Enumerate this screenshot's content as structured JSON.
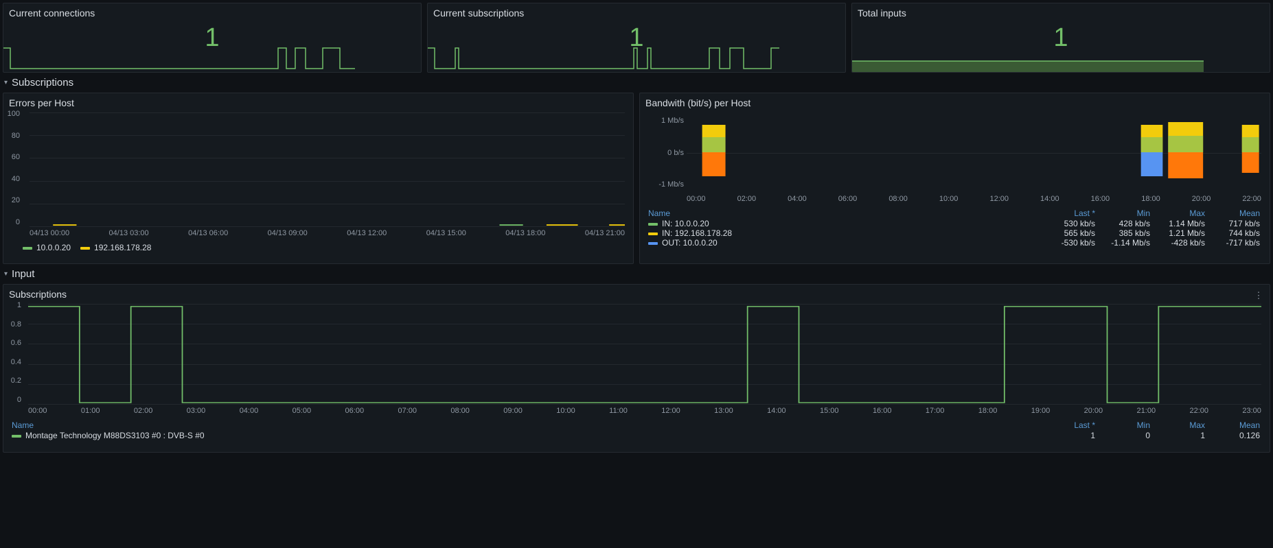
{
  "stats": {
    "connections": {
      "title": "Current connections",
      "value": "1"
    },
    "subscriptions": {
      "title": "Current subscriptions",
      "value": "1"
    },
    "inputs": {
      "title": "Total inputs",
      "value": "1"
    }
  },
  "sections": {
    "subscriptions": "Subscriptions",
    "input": "Input"
  },
  "errors_panel": {
    "title": "Errors per Host",
    "y_ticks": [
      "100",
      "80",
      "60",
      "40",
      "20",
      "0"
    ],
    "x_ticks": [
      "04/13 00:00",
      "04/13 03:00",
      "04/13 06:00",
      "04/13 09:00",
      "04/13 12:00",
      "04/13 15:00",
      "04/13 18:00",
      "04/13 21:00"
    ],
    "legend": [
      {
        "color": "#73bf69",
        "label": "10.0.0.20"
      },
      {
        "color": "#f2cc0c",
        "label": "192.168.178.28"
      }
    ]
  },
  "bandwidth_panel": {
    "title": "Bandwith (bit/s) per Host",
    "y_ticks": [
      "1 Mb/s",
      "0 b/s",
      "-1 Mb/s"
    ],
    "x_ticks": [
      "00:00",
      "02:00",
      "04:00",
      "06:00",
      "08:00",
      "10:00",
      "12:00",
      "14:00",
      "16:00",
      "18:00",
      "20:00",
      "22:00"
    ],
    "headers": {
      "name": "Name",
      "last": "Last *",
      "min": "Min",
      "max": "Max",
      "mean": "Mean"
    },
    "rows": [
      {
        "color": "#73bf69",
        "name": "IN: 10.0.0.20",
        "last": "530 kb/s",
        "min": "428 kb/s",
        "max": "1.14 Mb/s",
        "mean": "717 kb/s"
      },
      {
        "color": "#f2cc0c",
        "name": "IN: 192.168.178.28",
        "last": "565 kb/s",
        "min": "385 kb/s",
        "max": "1.21 Mb/s",
        "mean": "744 kb/s"
      },
      {
        "color": "#5794f2",
        "name": "OUT: 10.0.0.20",
        "last": "-530 kb/s",
        "min": "-1.14 Mb/s",
        "max": "-428 kb/s",
        "mean": "-717 kb/s"
      }
    ]
  },
  "input_subs_panel": {
    "title": "Subscriptions",
    "y_ticks": [
      "1",
      "0.8",
      "0.6",
      "0.4",
      "0.2",
      "0"
    ],
    "x_ticks": [
      "00:00",
      "01:00",
      "02:00",
      "03:00",
      "04:00",
      "05:00",
      "06:00",
      "07:00",
      "08:00",
      "09:00",
      "10:00",
      "11:00",
      "12:00",
      "13:00",
      "14:00",
      "15:00",
      "16:00",
      "17:00",
      "18:00",
      "19:00",
      "20:00",
      "21:00",
      "22:00",
      "23:00"
    ],
    "headers": {
      "name": "Name",
      "last": "Last *",
      "min": "Min",
      "max": "Max",
      "mean": "Mean"
    },
    "rows": [
      {
        "color": "#73bf69",
        "name": "Montage Technology M88DS3103 #0 : DVB-S #0",
        "last": "1",
        "min": "0",
        "max": "1",
        "mean": "0.126"
      }
    ]
  },
  "chart_data": [
    {
      "id": "current_connections_spark",
      "type": "line",
      "title": "Current connections",
      "x_unit": "hour_of_day",
      "y_unit": "count",
      "x": [
        0,
        1,
        2,
        3,
        4,
        5,
        6,
        7,
        8,
        9,
        10,
        11,
        12,
        13,
        14,
        15,
        16,
        17,
        18,
        19,
        20,
        21,
        22,
        23
      ],
      "values": [
        1,
        0,
        0,
        0,
        0,
        0,
        0,
        0,
        0,
        0,
        0,
        0,
        0,
        0,
        0,
        0,
        0,
        0,
        0,
        1,
        1,
        0,
        1,
        1
      ]
    },
    {
      "id": "current_subscriptions_spark",
      "type": "line",
      "title": "Current subscriptions",
      "x_unit": "hour_of_day",
      "y_unit": "count",
      "x": [
        0,
        1,
        2,
        3,
        4,
        5,
        6,
        7,
        8,
        9,
        10,
        11,
        12,
        13,
        14,
        15,
        16,
        17,
        18,
        19,
        20,
        21,
        22,
        23
      ],
      "values": [
        1,
        0,
        0,
        0,
        0,
        0,
        0,
        0,
        0,
        0,
        0,
        0,
        0,
        0,
        1,
        0,
        0,
        0,
        0,
        1,
        1,
        0,
        1,
        1
      ]
    },
    {
      "id": "total_inputs_spark",
      "type": "area",
      "title": "Total inputs",
      "x_unit": "hour_of_day",
      "y_unit": "count",
      "x": [
        0,
        24
      ],
      "values": [
        1,
        1
      ]
    },
    {
      "id": "errors_per_host",
      "type": "line",
      "title": "Errors per Host",
      "xlabel": "",
      "ylabel": "errors",
      "x": [
        "04/13 00:00",
        "04/13 03:00",
        "04/13 06:00",
        "04/13 09:00",
        "04/13 12:00",
        "04/13 15:00",
        "04/13 18:00",
        "04/13 21:00"
      ],
      "ylim": [
        0,
        100
      ],
      "series": [
        {
          "name": "10.0.0.20",
          "values": [
            0,
            0,
            0,
            0,
            0,
            0,
            0,
            0
          ]
        },
        {
          "name": "192.168.178.28",
          "values": [
            0,
            0,
            0,
            0,
            0,
            0,
            0,
            0
          ]
        }
      ]
    },
    {
      "id": "bandwidth_per_host",
      "type": "bar",
      "title": "Bandwith (bit/s) per Host",
      "xlabel": "",
      "ylabel": "bit/s",
      "x": [
        "00:00",
        "02:00",
        "04:00",
        "06:00",
        "08:00",
        "10:00",
        "12:00",
        "14:00",
        "16:00",
        "18:00",
        "20:00",
        "22:00"
      ],
      "ylim": [
        -1200000,
        1200000
      ],
      "series": [
        {
          "name": "IN: 10.0.0.20",
          "values": [
            700000,
            0,
            0,
            0,
            0,
            0,
            0,
            0,
            0,
            700000,
            700000,
            700000
          ]
        },
        {
          "name": "IN: 192.168.178.28",
          "values": [
            740000,
            0,
            0,
            0,
            0,
            0,
            0,
            0,
            0,
            740000,
            740000,
            740000
          ]
        },
        {
          "name": "OUT: 10.0.0.20",
          "values": [
            -700000,
            0,
            0,
            0,
            0,
            0,
            0,
            0,
            0,
            -700000,
            -700000,
            -700000
          ]
        }
      ]
    },
    {
      "id": "input_subscriptions",
      "type": "line",
      "title": "Subscriptions",
      "xlabel": "",
      "ylabel": "count",
      "x": [
        "00:00",
        "01:00",
        "02:00",
        "03:00",
        "04:00",
        "05:00",
        "06:00",
        "07:00",
        "08:00",
        "09:00",
        "10:00",
        "11:00",
        "12:00",
        "13:00",
        "14:00",
        "15:00",
        "16:00",
        "17:00",
        "18:00",
        "19:00",
        "20:00",
        "21:00",
        "22:00",
        "23:00"
      ],
      "ylim": [
        0,
        1
      ],
      "series": [
        {
          "name": "Montage Technology M88DS3103 #0 : DVB-S #0",
          "values": [
            1,
            0,
            1,
            0,
            0,
            0,
            0,
            0,
            0,
            0,
            0,
            0,
            0,
            0,
            1,
            0,
            0,
            0,
            0,
            1,
            1,
            0,
            1,
            1
          ]
        }
      ]
    }
  ]
}
